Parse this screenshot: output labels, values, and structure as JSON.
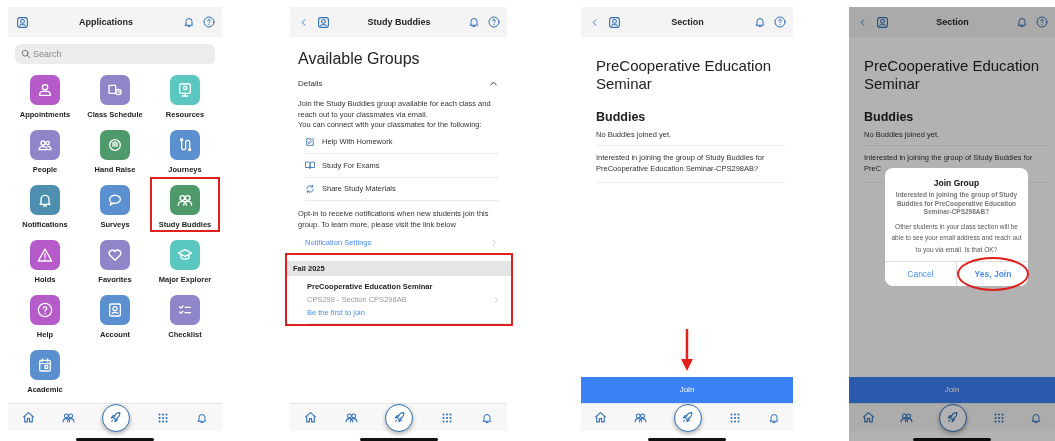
{
  "phones": [
    {
      "kind": "applications",
      "dimmed": false,
      "header": {
        "title": "Applications",
        "back": false
      },
      "search": {
        "placeholder": "Search"
      },
      "apps": [
        {
          "label": "Appointments",
          "color": "#b65ac9",
          "highlighted": false
        },
        {
          "label": "Class Schedule",
          "color": "#8e86c9",
          "highlighted": false
        },
        {
          "label": "Resources",
          "color": "#5ac8c0",
          "highlighted": false
        },
        {
          "label": "People",
          "color": "#8e86c9",
          "highlighted": false
        },
        {
          "label": "Hand Raise",
          "color": "#4f9a6a",
          "highlighted": false
        },
        {
          "label": "Journeys",
          "color": "#5a8fd0",
          "highlighted": false
        },
        {
          "label": "Notifications",
          "color": "#4e8fb0",
          "highlighted": false
        },
        {
          "label": "Surveys",
          "color": "#5a8fd0",
          "highlighted": false
        },
        {
          "label": "Study Buddies",
          "color": "#4f9a6a",
          "highlighted": true
        },
        {
          "label": "Holds",
          "color": "#b65ac9",
          "highlighted": false
        },
        {
          "label": "Favorites",
          "color": "#8e86c9",
          "highlighted": false
        },
        {
          "label": "Major Explorer",
          "color": "#5ac8c0",
          "highlighted": false
        },
        {
          "label": "Help",
          "color": "#b65ac9",
          "highlighted": false
        },
        {
          "label": "Account",
          "color": "#5a8fd0",
          "highlighted": false
        },
        {
          "label": "Checklist",
          "color": "#8e86c9",
          "highlighted": false
        },
        {
          "label": "Academic",
          "color": "#5a8fd0",
          "highlighted": false
        }
      ]
    },
    {
      "kind": "groups",
      "dimmed": false,
      "header": {
        "title": "Study Buddies",
        "back": true
      },
      "heading": "Available Groups",
      "details": {
        "label": "Details",
        "expanded": true,
        "intro": "Join the Study Buddies group available for each class and reach out to your classmates via email.",
        "intro_2": "You can connect with your classmates for the following:",
        "uses": [
          "Help With Homework",
          "Study For Exams",
          "Share Study Materials"
        ],
        "optin": "Opt-in to receive notifications when new students join this group. To learn more, please visit the link below",
        "link": "Notification Settings"
      },
      "terms": [
        {
          "term": "Fall 2025",
          "highlighted": true,
          "sections": [
            {
              "title": "PreCooperative Education Seminar",
              "code": "CPS298 - Section CPS298AB",
              "status": "Be the first to join"
            }
          ]
        }
      ]
    },
    {
      "kind": "section",
      "dimmed": false,
      "header": {
        "title": "Section",
        "back": true
      },
      "title": "PreCooperative Education Seminar",
      "buddies_heading": "Buddies",
      "empty": "No Buddies joined yet.",
      "prompt": "Interested in joining the group of Study Buddies for PreCooperative Education Seminar-CPS298AB?",
      "join": {
        "label": "Join",
        "highlighted": true
      }
    },
    {
      "kind": "section",
      "dimmed": true,
      "header": {
        "title": "Section",
        "back": true
      },
      "title": "PreCooperative Education Seminar",
      "buddies_heading": "Buddies",
      "empty": "No Buddies joined yet.",
      "prompt": "Interested in joining the group of Study Buddies for PreC",
      "join": {
        "label": "Join",
        "highlighted": false
      },
      "dialog": {
        "title": "Join Group",
        "message": "Interested in joining the group of Study Buddies for PreCooperative Education Seminar-CPS298AB?",
        "detail": "Other students in your class section will be able to see your email address and reach out to you via email. Is that OK?",
        "buttons": [
          {
            "label": "Cancel",
            "kind": "cancel",
            "highlighted": false
          },
          {
            "label": "Yes, Join",
            "kind": "confirm",
            "highlighted": true
          }
        ]
      }
    }
  ]
}
